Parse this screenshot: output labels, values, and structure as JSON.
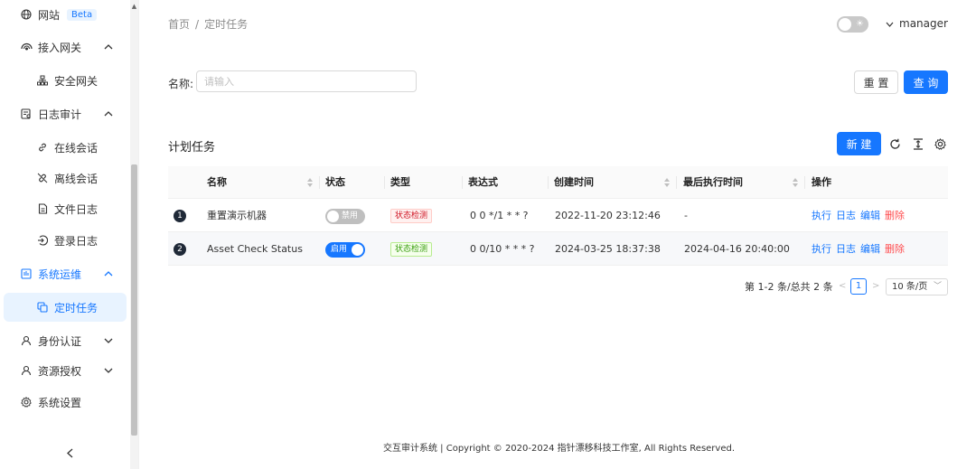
{
  "sidebar": {
    "website": {
      "label": "网站",
      "badge": "Beta"
    },
    "access_gateway": {
      "label": "接入网关"
    },
    "security_gateway": {
      "label": "安全网关"
    },
    "audit_logs": {
      "label": "日志审计"
    },
    "online_sessions": {
      "label": "在线会话"
    },
    "offline_sessions": {
      "label": "离线会话"
    },
    "file_logs": {
      "label": "文件日志"
    },
    "login_logs": {
      "label": "登录日志"
    },
    "ops": {
      "label": "系统运维"
    },
    "scheduled_tasks": {
      "label": "定时任务"
    },
    "identity": {
      "label": "身份认证"
    },
    "resource_auth": {
      "label": "资源授权"
    },
    "settings": {
      "label": "系统设置"
    }
  },
  "header": {
    "breadcrumb": [
      "首页",
      "定时任务"
    ],
    "user": "manager"
  },
  "filter": {
    "name_label": "名称:",
    "name_placeholder": "请输入",
    "reset_label": "重 置",
    "query_label": "查 询"
  },
  "table": {
    "title": "计划任务",
    "new_label": "新 建",
    "columns": [
      "名称",
      "状态",
      "类型",
      "表达式",
      "创建时间",
      "最后执行时间",
      "操作"
    ],
    "rows": [
      {
        "index": "1",
        "name": "重置演示机器",
        "status": "禁用",
        "status_on": false,
        "type": "状态检测",
        "type_color": "red",
        "expr": "0 0 */1 * * ?",
        "created": "2022-11-20 23:12:46",
        "last_run": "-"
      },
      {
        "index": "2",
        "name": "Asset Check Status",
        "status": "启用",
        "status_on": true,
        "type": "状态检测",
        "type_color": "green",
        "expr": "0 0/10 * * * ?",
        "created": "2024-03-25 18:37:38",
        "last_run": "2024-04-16 20:40:00"
      }
    ],
    "actions": [
      "执行",
      "日志",
      "编辑",
      "删除"
    ]
  },
  "pagination": {
    "summary": "第 1-2 条/总共 2 条",
    "current_page": "1",
    "page_size": "10 条/页"
  },
  "footer": "交互审计系统 | Copyright © 2020-2024 指针漂移科技工作室, All Rights Reserved.",
  "colors": {
    "primary": "#1677ff",
    "danger": "#ff4d4f"
  }
}
